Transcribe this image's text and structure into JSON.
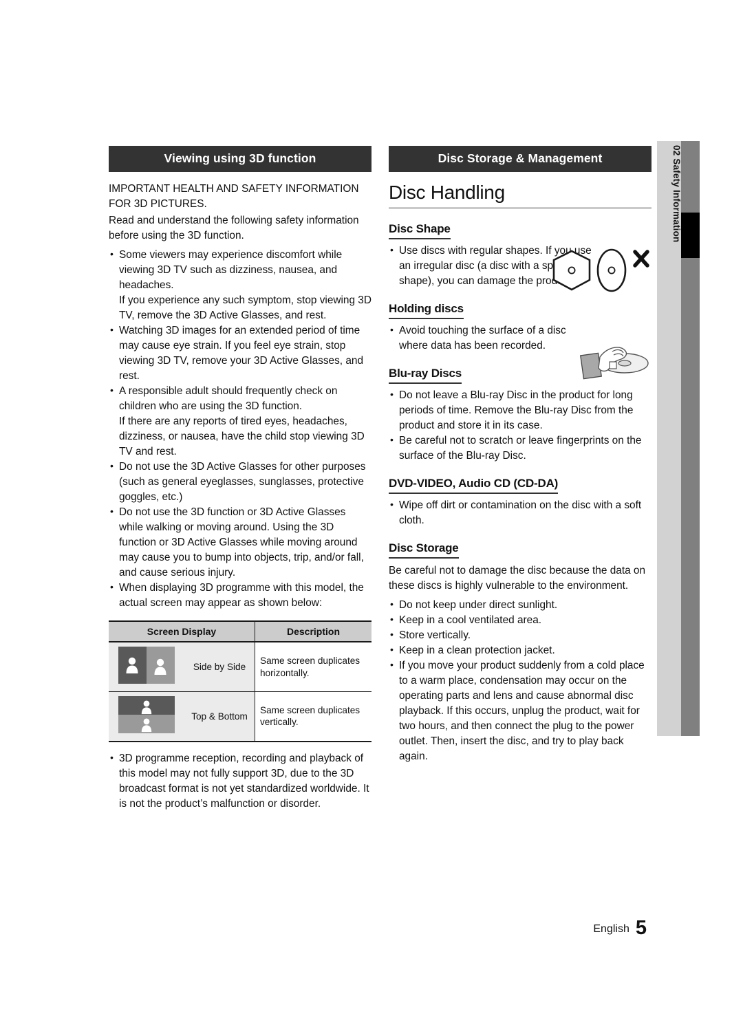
{
  "page": {
    "language_label": "English",
    "page_number": "5",
    "side_tab_text": "02  Safety Information",
    "colors": {
      "banner_bg": "#333333",
      "side_tab_bg": "#d2d2d2",
      "side_bar_gray": "#808080",
      "side_bar_black": "#000000",
      "table_header_bg": "#cccccc",
      "table_cell_bg": "#ebebeb",
      "rule_gray": "#c9c9c9"
    }
  },
  "left_column": {
    "banner": "Viewing using 3D function",
    "intro": "IMPORTANT HEALTH AND SAFETY INFORMATION FOR 3D PICTURES.",
    "intro2": "Read and understand the following safety information before using the 3D function.",
    "bullets": [
      {
        "main": "Some viewers may experience discomfort while viewing 3D TV such as dizziness, nausea, and headaches.",
        "cont": "If you experience any such symptom, stop viewing 3D TV, remove the 3D Active Glasses, and rest."
      },
      {
        "main": "Watching 3D images for an extended period of time may cause eye strain. If you feel eye strain, stop viewing 3D TV, remove your 3D Active Glasses, and rest.",
        "cont": ""
      },
      {
        "main": "A responsible adult should frequently check on children who are using the 3D function.",
        "cont": "If there are any reports of tired eyes, headaches, dizziness, or nausea, have the child stop viewing 3D TV and rest."
      },
      {
        "main": "Do not use the 3D Active Glasses for other purposes (such as general eyeglasses, sunglasses, protective goggles, etc.)",
        "cont": ""
      },
      {
        "main": "Do not use the 3D function or 3D Active Glasses while walking or moving around. Using the 3D function or 3D Active Glasses while moving around may cause you to bump into objects, trip, and/or fall, and cause serious injury.",
        "cont": ""
      },
      {
        "main": "When displaying 3D programme with this model, the actual screen may appear as shown below:",
        "cont": ""
      }
    ],
    "table": {
      "headers": [
        "Screen Display",
        "Description"
      ],
      "rows": [
        {
          "label": "Side by Side",
          "description": "Same screen duplicates horizontally.",
          "thumb": "side-by-side-thumbnail"
        },
        {
          "label": "Top & Bottom",
          "description": "Same screen duplicates vertically.",
          "thumb": "top-and-bottom-thumbnail"
        }
      ]
    },
    "bullets_after_table": [
      "3D programme reception, recording and playback of this model may not fully support 3D, due to the 3D broadcast format is not yet standardized worldwide. It is not the product’s malfunction or disorder."
    ]
  },
  "right_column": {
    "banner": "Disc Storage & Management",
    "title": "Disc Handling",
    "sections": [
      {
        "heading": "Disc Shape",
        "bullets": [
          "Use discs with regular shapes. If you use an irregular disc (a disc with a special shape), you can damage the product."
        ],
        "figure": "irregular-disc-shapes-figure"
      },
      {
        "heading": "Holding discs",
        "bullets": [
          "Avoid touching the surface of a disc where data has been recorded."
        ],
        "figure": "hand-holding-disc-figure"
      },
      {
        "heading": "Blu-ray Discs",
        "bullets": [
          "Do not leave a Blu-ray Disc in the product for long periods of time. Remove the Blu-ray Disc from the product and store it in its case.",
          "Be careful not to scratch or leave fingerprints on the surface of the Blu-ray Disc."
        ],
        "figure": ""
      },
      {
        "heading": "DVD-VIDEO, Audio CD (CD-DA)",
        "bullets": [
          "Wipe off dirt or contamination on the disc with a soft cloth."
        ],
        "figure": ""
      },
      {
        "heading": "Disc Storage",
        "intro": "Be careful not to damage the disc because the data on these discs is highly vulnerable to the environment.",
        "bullets": [
          "Do not keep under direct sunlight.",
          "Keep in a cool ventilated area.",
          "Store vertically.",
          "Keep in a clean protection jacket.",
          "If you move your product suddenly from a cold place to a warm place, condensation may occur on the operating parts and lens and cause abnormal disc playback. If this occurs, unplug the product, wait for two hours, and then connect the plug to the power outlet. Then, insert the disc, and try to play back again."
        ],
        "figure": ""
      }
    ]
  }
}
